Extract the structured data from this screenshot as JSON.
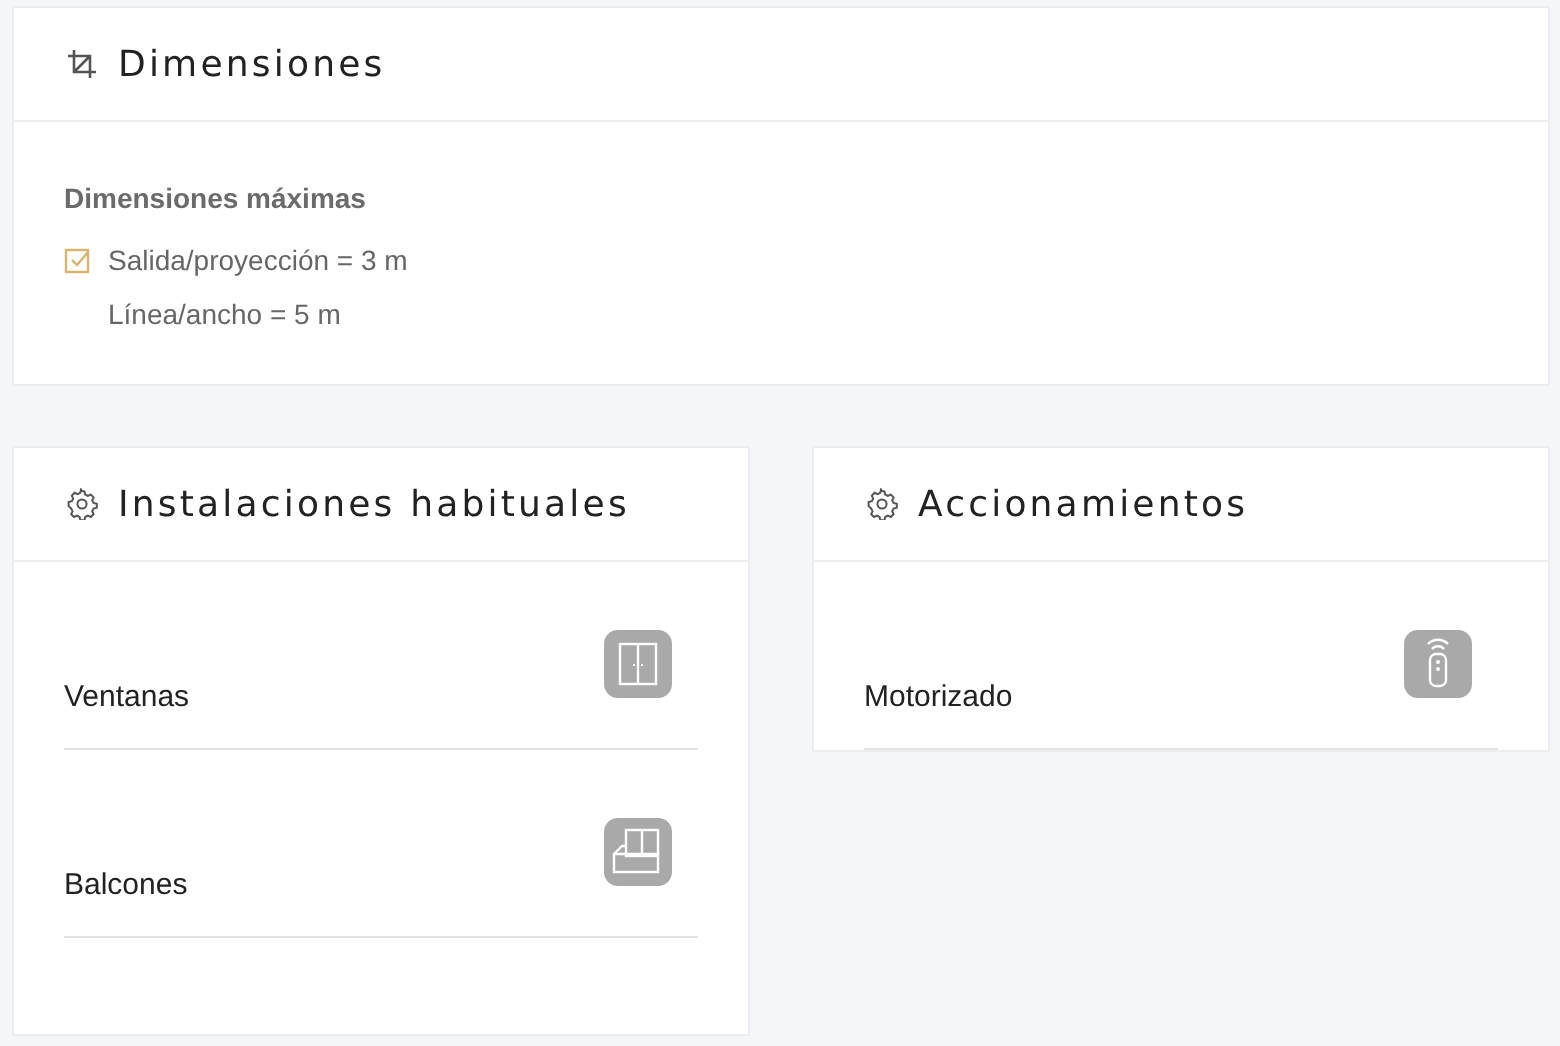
{
  "dimensions": {
    "title": "Dimensiones",
    "subtitle": "Dimensiones máximas",
    "lines": [
      {
        "text": "Salida/proyección = 3 m",
        "checked": true
      },
      {
        "text": "Línea/ancho = 5 m",
        "checked": false
      }
    ]
  },
  "panels": [
    {
      "title": "Instalaciones habituales",
      "items": [
        {
          "label": "Ventanas",
          "kind": "window"
        },
        {
          "label": "Balcones",
          "kind": "balcony"
        }
      ]
    },
    {
      "title": "Accionamientos",
      "items": [
        {
          "label": "Motorizado",
          "kind": "remote"
        }
      ]
    }
  ]
}
